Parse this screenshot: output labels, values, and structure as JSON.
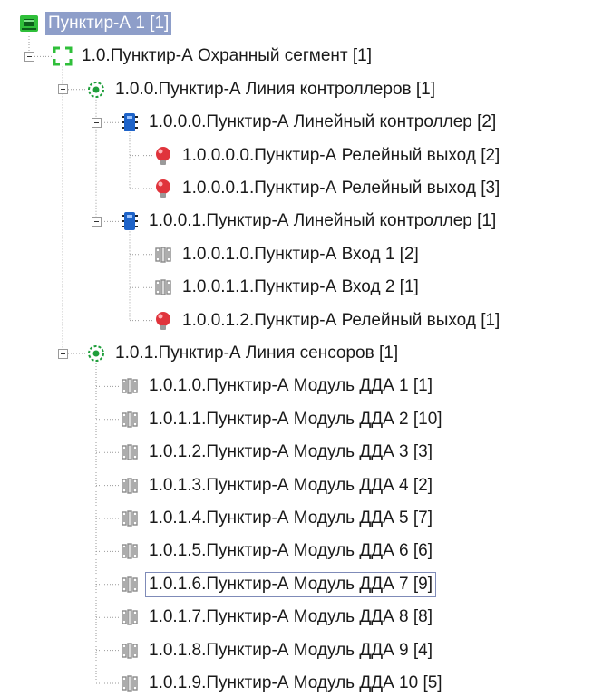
{
  "colors": {
    "selection": "#8e9ec9",
    "relay": "#e0343c",
    "controller": "#1e63c8",
    "segment": "#2fbf3a",
    "line": "#1e9e3a",
    "module": "#8a8a8a"
  },
  "tree": [
    {
      "label": "Пунктир-А 1 [1]",
      "icon": "device-board-icon",
      "level": 0,
      "toggle": false,
      "selected": true
    },
    {
      "label": "1.0.Пунктир-А Охранный сегмент [1]",
      "icon": "segment-bracket-icon",
      "level": 1,
      "toggle": true
    },
    {
      "label": "1.0.0.Пунктир-А Линия контроллеров [1]",
      "icon": "line-ring-icon",
      "level": 2,
      "toggle": true
    },
    {
      "label": "1.0.0.0.Пунктир-А Линейный контроллер [2]",
      "icon": "controller-chip-icon",
      "level": 3,
      "toggle": true
    },
    {
      "label": "1.0.0.0.0.Пунктир-А Релейный выход [2]",
      "icon": "relay-lamp-icon",
      "level": 4,
      "toggle": false
    },
    {
      "label": "1.0.0.0.1.Пунктир-А Релейный выход [3]",
      "icon": "relay-lamp-icon",
      "level": 4,
      "toggle": false
    },
    {
      "label": "1.0.0.1.Пунктир-А Линейный контроллер [1]",
      "icon": "controller-chip-icon",
      "level": 3,
      "toggle": true
    },
    {
      "label": "1.0.0.1.0.Пунктир-А Вход 1 [2]",
      "icon": "sensor-module-icon",
      "level": 4,
      "toggle": false
    },
    {
      "label": "1.0.0.1.1.Пунктир-А Вход 2 [1]",
      "icon": "sensor-module-icon",
      "level": 4,
      "toggle": false
    },
    {
      "label": "1.0.0.1.2.Пунктир-А Релейный выход [1]",
      "icon": "relay-lamp-icon",
      "level": 4,
      "toggle": false
    },
    {
      "label": "1.0.1.Пунктир-А Линия сенсоров [1]",
      "icon": "line-ring-icon",
      "level": 2,
      "toggle": true
    },
    {
      "label": "1.0.1.0.Пунктир-А Модуль ДДА 1 [1]",
      "icon": "sensor-module-icon",
      "level": 3,
      "toggle": false
    },
    {
      "label": "1.0.1.1.Пунктир-А Модуль ДДА 2 [10]",
      "icon": "sensor-module-icon",
      "level": 3,
      "toggle": false
    },
    {
      "label": "1.0.1.2.Пунктир-А Модуль ДДА 3 [3]",
      "icon": "sensor-module-icon",
      "level": 3,
      "toggle": false
    },
    {
      "label": "1.0.1.3.Пунктир-А Модуль ДДА 4 [2]",
      "icon": "sensor-module-icon",
      "level": 3,
      "toggle": false
    },
    {
      "label": "1.0.1.4.Пунктир-А Модуль ДДА 5 [7]",
      "icon": "sensor-module-icon",
      "level": 3,
      "toggle": false
    },
    {
      "label": "1.0.1.5.Пунктир-А Модуль ДДА 6 [6]",
      "icon": "sensor-module-icon",
      "level": 3,
      "toggle": false
    },
    {
      "label": "1.0.1.6.Пунктир-А Модуль ДДА 7 [9]",
      "icon": "sensor-module-icon",
      "level": 3,
      "toggle": false,
      "focused": true
    },
    {
      "label": "1.0.1.7.Пунктир-А Модуль ДДА 8 [8]",
      "icon": "sensor-module-icon",
      "level": 3,
      "toggle": false
    },
    {
      "label": "1.0.1.8.Пунктир-А Модуль ДДА 9 [4]",
      "icon": "sensor-module-icon",
      "level": 3,
      "toggle": false
    },
    {
      "label": "1.0.1.9.Пунктир-А Модуль ДДА 10 [5]",
      "icon": "sensor-module-icon",
      "level": 3,
      "toggle": false
    }
  ]
}
